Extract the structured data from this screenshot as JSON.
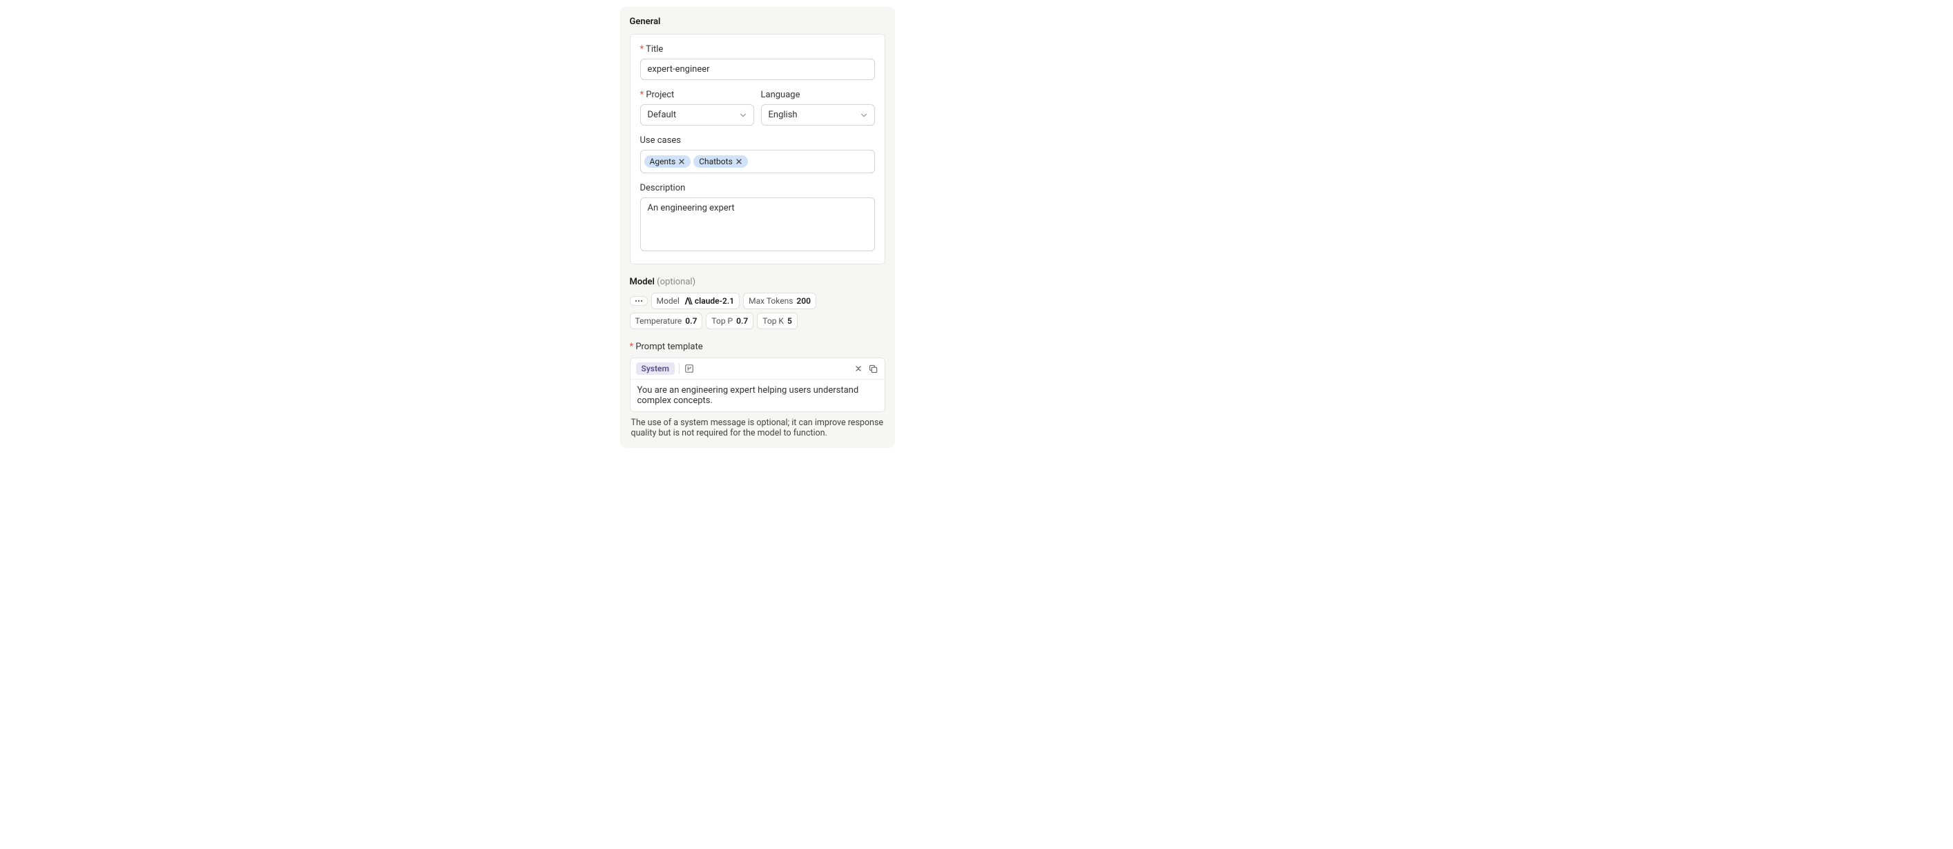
{
  "general": {
    "section_title": "General",
    "title_label": "Title",
    "title_value": "expert-engineer",
    "project_label": "Project",
    "project_value": "Default",
    "language_label": "Language",
    "language_value": "English",
    "use_cases_label": "Use cases",
    "use_cases": [
      "Agents",
      "Chatbots"
    ],
    "description_label": "Description",
    "description_value": "An engineering expert"
  },
  "model": {
    "section_title": "Model",
    "optional_suffix": "(optional)",
    "model_label": "Model",
    "model_value": "claude-2.1",
    "max_tokens_label": "Max Tokens",
    "max_tokens_value": "200",
    "temperature_label": "Temperature",
    "temperature_value": "0.7",
    "top_p_label": "Top P",
    "top_p_value": "0.7",
    "top_k_label": "Top K",
    "top_k_value": "5"
  },
  "prompt": {
    "section_title": "Prompt template",
    "system_badge": "System",
    "system_content": "You are an engineering expert helping users understand complex concepts.",
    "hint": "The use of a system message is optional; it can improve response quality but is not required for the model to function."
  }
}
